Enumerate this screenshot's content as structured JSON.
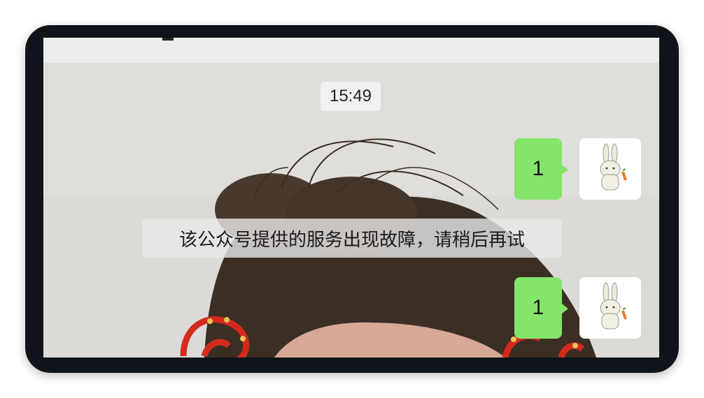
{
  "chat": {
    "timestamp": "15:49",
    "messages": [
      {
        "text": "1",
        "side": "right"
      },
      {
        "text": "1",
        "side": "right"
      }
    ],
    "system_notice": "该公众号提供的服务出现故障，请稍后再试"
  },
  "colors": {
    "frame": "#0f131a",
    "bubble_green": "#85e46a",
    "hair_accessory": "#d42a1e"
  }
}
